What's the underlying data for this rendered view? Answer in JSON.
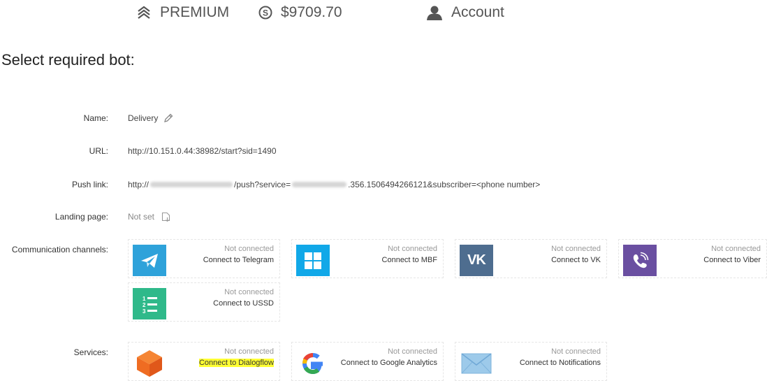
{
  "topbar": {
    "plan": "PREMIUM",
    "balance": "$9709.70",
    "account": "Account"
  },
  "heading": "Select required bot:",
  "fields": {
    "name": {
      "label": "Name:",
      "value": "Delivery"
    },
    "url": {
      "label": "URL:",
      "value": "http://10.151.0.44:38982/start?sid=1490"
    },
    "push": {
      "label": "Push link:",
      "prefix": "http://",
      "middle": "/push?service=",
      "suffix": ".356.1506494266121&subscriber=<phone number>"
    },
    "landing": {
      "label": "Landing page:",
      "value": "Not set"
    }
  },
  "channels": {
    "label": "Communication channels:",
    "items": [
      {
        "status": "Not connected",
        "action": "Connect to Telegram",
        "icon": "telegram-icon",
        "color": "#2ea2da"
      },
      {
        "status": "Not connected",
        "action": "Connect to MBF",
        "icon": "windows-icon",
        "color": "#11a8e8"
      },
      {
        "status": "Not connected",
        "action": "Connect to VK",
        "icon": "vk-icon",
        "color": "#4e6d8f"
      },
      {
        "status": "Not connected",
        "action": "Connect to Viber",
        "icon": "viber-icon",
        "color": "#6a4fa1"
      },
      {
        "status": "Not connected",
        "action": "Connect to USSD",
        "icon": "ussd-list-icon",
        "color": "#2fb98a"
      }
    ]
  },
  "services": {
    "label": "Services:",
    "items": [
      {
        "status": "Not connected",
        "action": "Connect to Dialogflow",
        "icon": "dialogflow-icon",
        "color": "#f26b22"
      },
      {
        "status": "Not connected",
        "action": "Connect to Google Analytics",
        "icon": "google-icon",
        "color": "#4285f4"
      },
      {
        "status": "Not connected",
        "action": "Connect to Notifications",
        "icon": "mail-icon",
        "color": "#8ec3e8"
      }
    ]
  }
}
